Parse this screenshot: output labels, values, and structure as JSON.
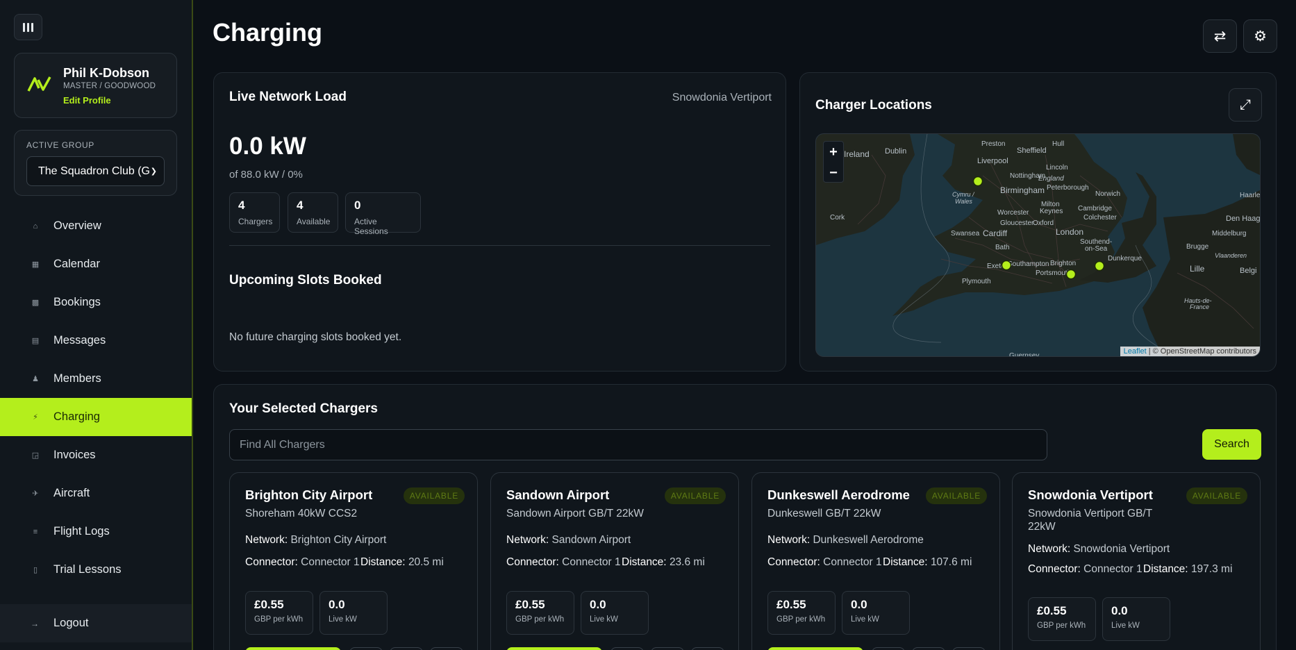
{
  "sidebar": {
    "profile": {
      "name": "Phil K-Dobson",
      "role": "MASTER / GOODWOOD",
      "edit_label": "Edit Profile"
    },
    "group": {
      "label": "ACTIVE GROUP",
      "selected": "The Squadron Club (G"
    },
    "nav": [
      {
        "label": "Overview",
        "icon": "home-icon"
      },
      {
        "label": "Calendar",
        "icon": "calendar-icon"
      },
      {
        "label": "Bookings",
        "icon": "bookings-icon"
      },
      {
        "label": "Messages",
        "icon": "messages-icon"
      },
      {
        "label": "Members",
        "icon": "members-icon"
      },
      {
        "label": "Charging",
        "icon": "charging-icon",
        "active": true
      },
      {
        "label": "Invoices",
        "icon": "cart-icon"
      },
      {
        "label": "Aircraft",
        "icon": "plane-icon"
      },
      {
        "label": "Flight Logs",
        "icon": "list-icon"
      },
      {
        "label": "Trial Lessons",
        "icon": "bookmark-icon"
      }
    ],
    "logout_label": "Logout"
  },
  "header": {
    "title": "Charging"
  },
  "load": {
    "title": "Live Network Load",
    "location": "Snowdonia Vertiport",
    "value": "0.0 kW",
    "sub": "of 88.0 kW / 0%",
    "stats": [
      {
        "value": "4",
        "label": "Chargers"
      },
      {
        "value": "4",
        "label": "Available"
      },
      {
        "value": "0",
        "label": "Active Sessions"
      }
    ],
    "upcoming_title": "Upcoming Slots Booked",
    "empty_message": "No future charging slots booked yet."
  },
  "map": {
    "title": "Charger Locations",
    "attribution_leaflet": "Leaflet",
    "attribution_rest": " | © OpenStreetMap contributors",
    "labels": [
      "Ireland",
      "Dublin",
      "Preston",
      "Sheffield",
      "Hull",
      "Liverpool",
      "Lincoln",
      "Nottingham",
      "England",
      "Cymru / Wales",
      "Birmingham",
      "Peterborough",
      "Norwich",
      "Cork",
      "Worcester",
      "Milton Keynes",
      "Cambridge",
      "Colchester",
      "Gloucester",
      "Oxford",
      "Haarle",
      "Den Haag",
      "Swansea",
      "Cardiff",
      "London",
      "Southend-on-Sea",
      "Middelburg",
      "Bath",
      "Brugge",
      "Exeter",
      "Southampton",
      "Brighton",
      "Dunkerque",
      "Vlaanderen",
      "Plymouth",
      "Portsmouth",
      "Lille",
      "Belgi",
      "Hauts-de-France",
      "Guernsey"
    ]
  },
  "selected": {
    "title": "Your Selected Chargers",
    "search_placeholder": "Find All Chargers",
    "search_button": "Search",
    "network_label": "Network:",
    "connector_label": "Connector:",
    "distance_label": "Distance:",
    "price_label": "GBP per kWh",
    "live_label": "Live kW",
    "chargers": [
      {
        "name": "Brighton City Airport",
        "status": "AVAILABLE",
        "model": "Shoreham 40kW CCS2",
        "network": "Brighton City Airport",
        "connector": "Connector 1",
        "distance": "20.5 mi",
        "price": "£0.55",
        "live": "0.0"
      },
      {
        "name": "Sandown Airport",
        "status": "AVAILABLE",
        "model": "Sandown Airport GB/T 22kW",
        "network": "Sandown Airport",
        "connector": "Connector 1",
        "distance": "23.6 mi",
        "price": "£0.55",
        "live": "0.0"
      },
      {
        "name": "Dunkeswell Aerodrome",
        "status": "AVAILABLE",
        "model": "Dunkeswell GB/T 22kW",
        "network": "Dunkeswell Aerodrome",
        "connector": "Connector 1",
        "distance": "107.6 mi",
        "price": "£0.55",
        "live": "0.0"
      },
      {
        "name": "Snowdonia Vertiport",
        "status": "AVAILABLE",
        "model": "Snowdonia Vertiport GB/T 22kW",
        "network": "Snowdonia Vertiport",
        "connector": "Connector 1",
        "distance": "197.3 mi",
        "price": "£0.55",
        "live": "0.0"
      }
    ]
  },
  "colors": {
    "accent": "#b4ee1c",
    "background": "#0b1016",
    "panel": "#10161c",
    "map_water": "#1d3540",
    "map_land": "#1e211c"
  }
}
